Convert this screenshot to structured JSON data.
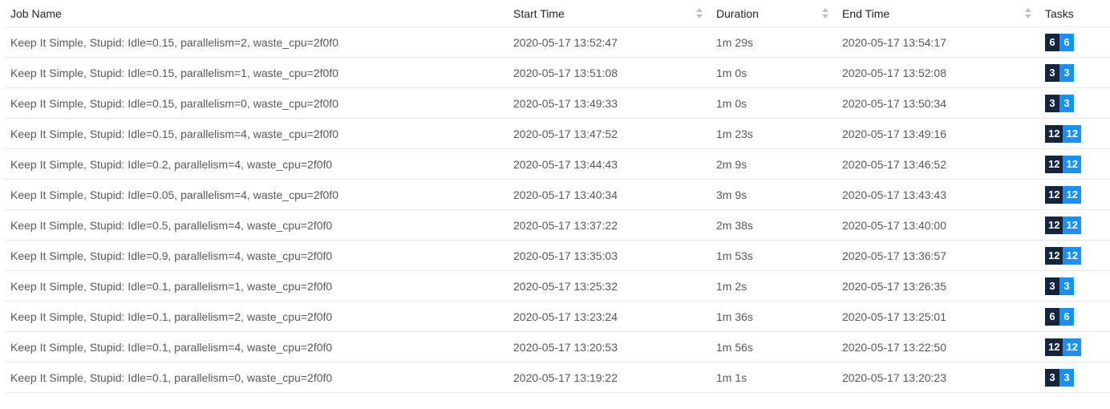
{
  "columns": {
    "job_name": "Job Name",
    "start_time": "Start Time",
    "duration": "Duration",
    "end_time": "End Time",
    "tasks": "Tasks"
  },
  "colors": {
    "tasks_total": "#13253f",
    "tasks_finished": "#1890ff",
    "header_text": "#262626",
    "cell_text": "#595959",
    "row_divider": "#e8e8e8"
  },
  "icons": {
    "sort": "caret-up-down-icon"
  },
  "rows": [
    {
      "name": "Keep It Simple, Stupid: Idle=0.15, parallelism=2, waste_cpu=2f0f0",
      "start": "2020-05-17 13:52:47",
      "duration": "1m 29s",
      "end": "2020-05-17 13:54:17",
      "tasks_total": "6",
      "tasks_finished": "6"
    },
    {
      "name": "Keep It Simple, Stupid: Idle=0.15, parallelism=1, waste_cpu=2f0f0",
      "start": "2020-05-17 13:51:08",
      "duration": "1m 0s",
      "end": "2020-05-17 13:52:08",
      "tasks_total": "3",
      "tasks_finished": "3"
    },
    {
      "name": "Keep It Simple, Stupid: Idle=0.15, parallelism=0, waste_cpu=2f0f0",
      "start": "2020-05-17 13:49:33",
      "duration": "1m 0s",
      "end": "2020-05-17 13:50:34",
      "tasks_total": "3",
      "tasks_finished": "3"
    },
    {
      "name": "Keep It Simple, Stupid: Idle=0.15, parallelism=4, waste_cpu=2f0f0",
      "start": "2020-05-17 13:47:52",
      "duration": "1m 23s",
      "end": "2020-05-17 13:49:16",
      "tasks_total": "12",
      "tasks_finished": "12"
    },
    {
      "name": "Keep It Simple, Stupid: Idle=0.2, parallelism=4, waste_cpu=2f0f0",
      "start": "2020-05-17 13:44:43",
      "duration": "2m 9s",
      "end": "2020-05-17 13:46:52",
      "tasks_total": "12",
      "tasks_finished": "12"
    },
    {
      "name": "Keep It Simple, Stupid: Idle=0.05, parallelism=4, waste_cpu=2f0f0",
      "start": "2020-05-17 13:40:34",
      "duration": "3m 9s",
      "end": "2020-05-17 13:43:43",
      "tasks_total": "12",
      "tasks_finished": "12"
    },
    {
      "name": "Keep It Simple, Stupid: Idle=0.5, parallelism=4, waste_cpu=2f0f0",
      "start": "2020-05-17 13:37:22",
      "duration": "2m 38s",
      "end": "2020-05-17 13:40:00",
      "tasks_total": "12",
      "tasks_finished": "12"
    },
    {
      "name": "Keep It Simple, Stupid: Idle=0.9, parallelism=4, waste_cpu=2f0f0",
      "start": "2020-05-17 13:35:03",
      "duration": "1m 53s",
      "end": "2020-05-17 13:36:57",
      "tasks_total": "12",
      "tasks_finished": "12"
    },
    {
      "name": "Keep It Simple, Stupid: Idle=0.1, parallelism=1, waste_cpu=2f0f0",
      "start": "2020-05-17 13:25:32",
      "duration": "1m 2s",
      "end": "2020-05-17 13:26:35",
      "tasks_total": "3",
      "tasks_finished": "3"
    },
    {
      "name": "Keep It Simple, Stupid: Idle=0.1, parallelism=2, waste_cpu=2f0f0",
      "start": "2020-05-17 13:23:24",
      "duration": "1m 36s",
      "end": "2020-05-17 13:25:01",
      "tasks_total": "6",
      "tasks_finished": "6"
    },
    {
      "name": "Keep It Simple, Stupid: Idle=0.1, parallelism=4, waste_cpu=2f0f0",
      "start": "2020-05-17 13:20:53",
      "duration": "1m 56s",
      "end": "2020-05-17 13:22:50",
      "tasks_total": "12",
      "tasks_finished": "12"
    },
    {
      "name": "Keep It Simple, Stupid: Idle=0.1, parallelism=0, waste_cpu=2f0f0",
      "start": "2020-05-17 13:19:22",
      "duration": "1m 1s",
      "end": "2020-05-17 13:20:23",
      "tasks_total": "3",
      "tasks_finished": "3"
    }
  ]
}
